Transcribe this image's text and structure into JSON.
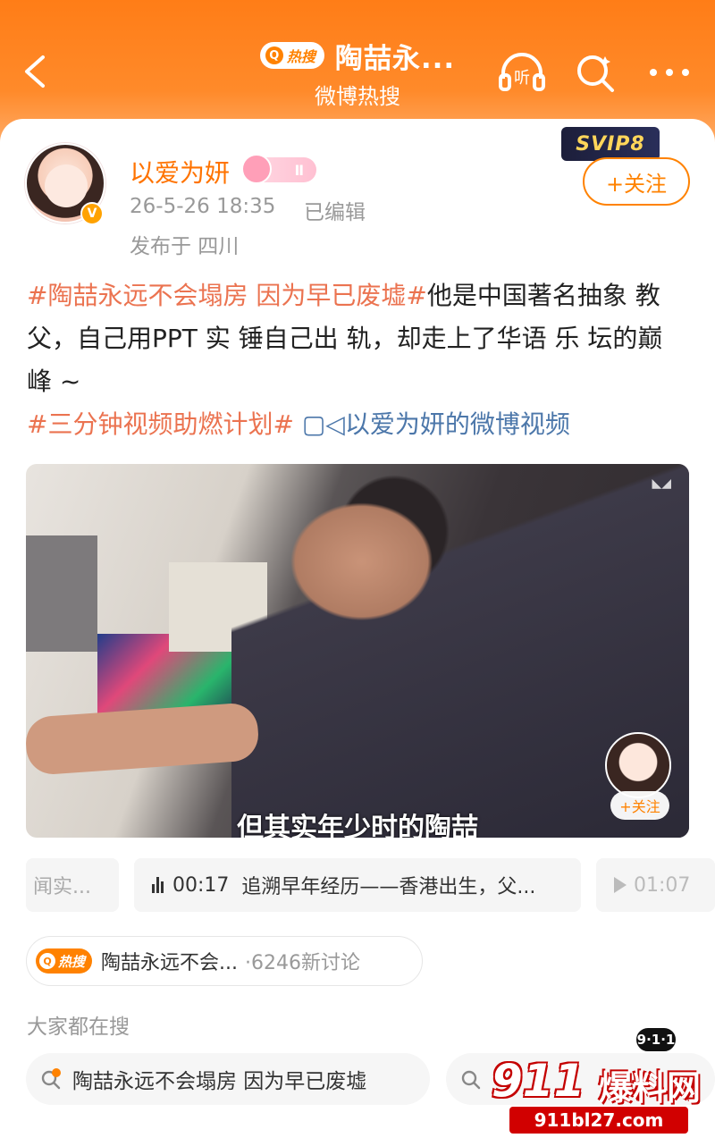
{
  "header": {
    "hot_badge": "热搜",
    "title": "陶喆永...",
    "subtitle": "微博热搜",
    "listen_label": "听"
  },
  "post": {
    "username": "以爱为妍",
    "level": "Ⅱ",
    "timestamp": "26-5-26 18:35",
    "edited": "已编辑",
    "location": "发布于 四川",
    "svip": "SVIP8",
    "follow_label": "+关注",
    "text": {
      "tag1": "#陶喆永远不会塌房 因为早已废墟#",
      "body": "他是中国著名抽象 教 父，自己用PPT 实 锤自己出 轨，却走上了华语 乐 坛的巅 峰 ~",
      "tag2": "#三分钟视频助燃计划#",
      "video_link": "以爱为妍的微博视频"
    }
  },
  "video": {
    "caption": "但其实年少时的陶喆",
    "mini_follow": "+关注"
  },
  "chapters": [
    {
      "label": "闻实..."
    },
    {
      "time": "00:17",
      "label": "追溯早年经历——香港出生，父..."
    },
    {
      "time": "01:07"
    }
  ],
  "hot_topic": {
    "badge": "热搜",
    "text": "陶喆永远不会...",
    "count": "·6246新讨论"
  },
  "also_search": {
    "heading": "大家都在搜",
    "items": [
      "陶喆永远不会塌房 因为早已废墟"
    ]
  },
  "watermark": {
    "brand": "911",
    "name": "爆料网",
    "url": "911bl27.com",
    "tag": "9·1·1"
  },
  "colors": {
    "accent": "#ff8200",
    "tag_orange": "#eb7350",
    "link_blue": "#4c77aa"
  }
}
